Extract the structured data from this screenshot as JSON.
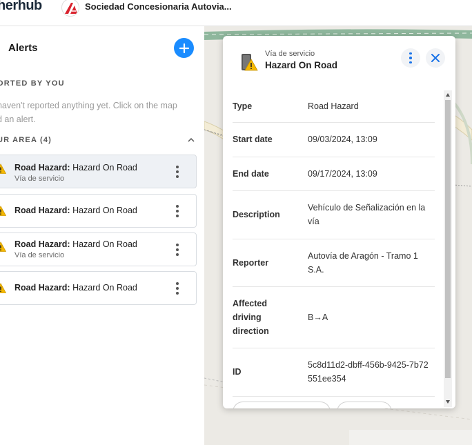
{
  "header": {
    "brand": "herhub",
    "org_name": "Sociedad Concesionaria Autovia...",
    "org_logo_text": "A"
  },
  "left_panel": {
    "title": "Alerts",
    "reported_label": "ORTED BY YOU",
    "empty_message_line1": "haven't reported anything yet. Click on the map",
    "empty_message_line2": "d an alert.",
    "area_label": "UR AREA (4)",
    "alerts": [
      {
        "type": "Road Hazard:",
        "name": "Hazard On Road",
        "sub": "Vía de servicio"
      },
      {
        "type": "Road Hazard:",
        "name": "Hazard On Road",
        "sub": ""
      },
      {
        "type": "Road Hazard:",
        "name": "Hazard On Road",
        "sub": "Vía de servicio"
      },
      {
        "type": "Road Hazard:",
        "name": "Hazard On Road",
        "sub": ""
      }
    ]
  },
  "popup": {
    "subtitle": "Vía de servicio",
    "title": "Hazard On Road",
    "details": [
      {
        "key": "Type",
        "value": "Road Hazard"
      },
      {
        "key": "Start date",
        "value": "09/03/2024, 13:09"
      },
      {
        "key": "End date",
        "value": "09/17/2024, 13:09"
      },
      {
        "key": "Description",
        "value": "Vehículo de Señalización en la vía"
      },
      {
        "key": "Reporter",
        "value": "Autovía de Aragón - Tramo 1 S.A."
      },
      {
        "key": "Affected driving direction",
        "value": "B→A"
      },
      {
        "key": "ID",
        "value": "5c8d11d2-dbff-456b-9425-7b72551ee354"
      }
    ]
  },
  "icons": [
    "plus-icon",
    "warning-icon",
    "kebab-icon",
    "close-icon",
    "chevron-up-icon",
    "org-logo"
  ],
  "colors": {
    "accent": "#1a8cff",
    "warning": "#f5b800",
    "close_blue": "#1a73e8",
    "map_bg": "#eceae5",
    "road_green": "#7fa98d"
  }
}
